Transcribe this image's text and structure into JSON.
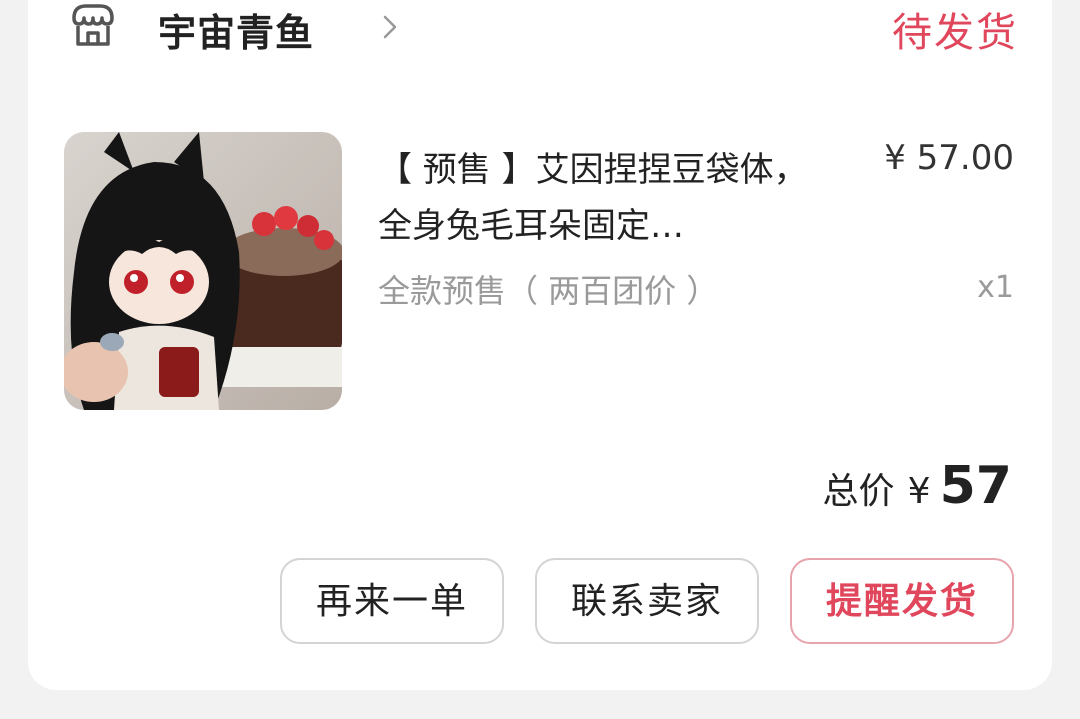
{
  "shop": {
    "name": "宇宙青鱼",
    "icon": "shop-icon"
  },
  "order": {
    "status": "待发货",
    "colors": {
      "accent": "#e0475c",
      "muted": "#9a9a9a"
    }
  },
  "product": {
    "title": "【 预售 】艾因捏捏豆袋体，全身兔毛耳朵固定…",
    "variant": "全款预售（ 两百团价 ）",
    "price": "¥ 57.00",
    "quantity": "x1"
  },
  "summary": {
    "label": "总价",
    "currency": "¥",
    "value": "57"
  },
  "actions": {
    "reorder": "再来一单",
    "contact": "联系卖家",
    "remind": "提醒发货"
  }
}
